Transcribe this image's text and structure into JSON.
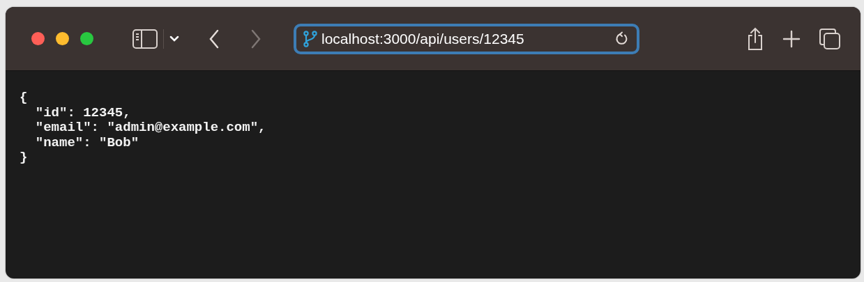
{
  "toolbar": {
    "back": {
      "disabled": false
    },
    "forward": {
      "disabled": true
    }
  },
  "address_bar": {
    "value": "localhost:3000/api/users/12345",
    "focused": true
  },
  "content": {
    "lines": [
      "{",
      "  \"id\": 12345,",
      "  \"email\": \"admin@example.com\",",
      "  \"name\": \"Bob\"",
      "}"
    ]
  }
}
